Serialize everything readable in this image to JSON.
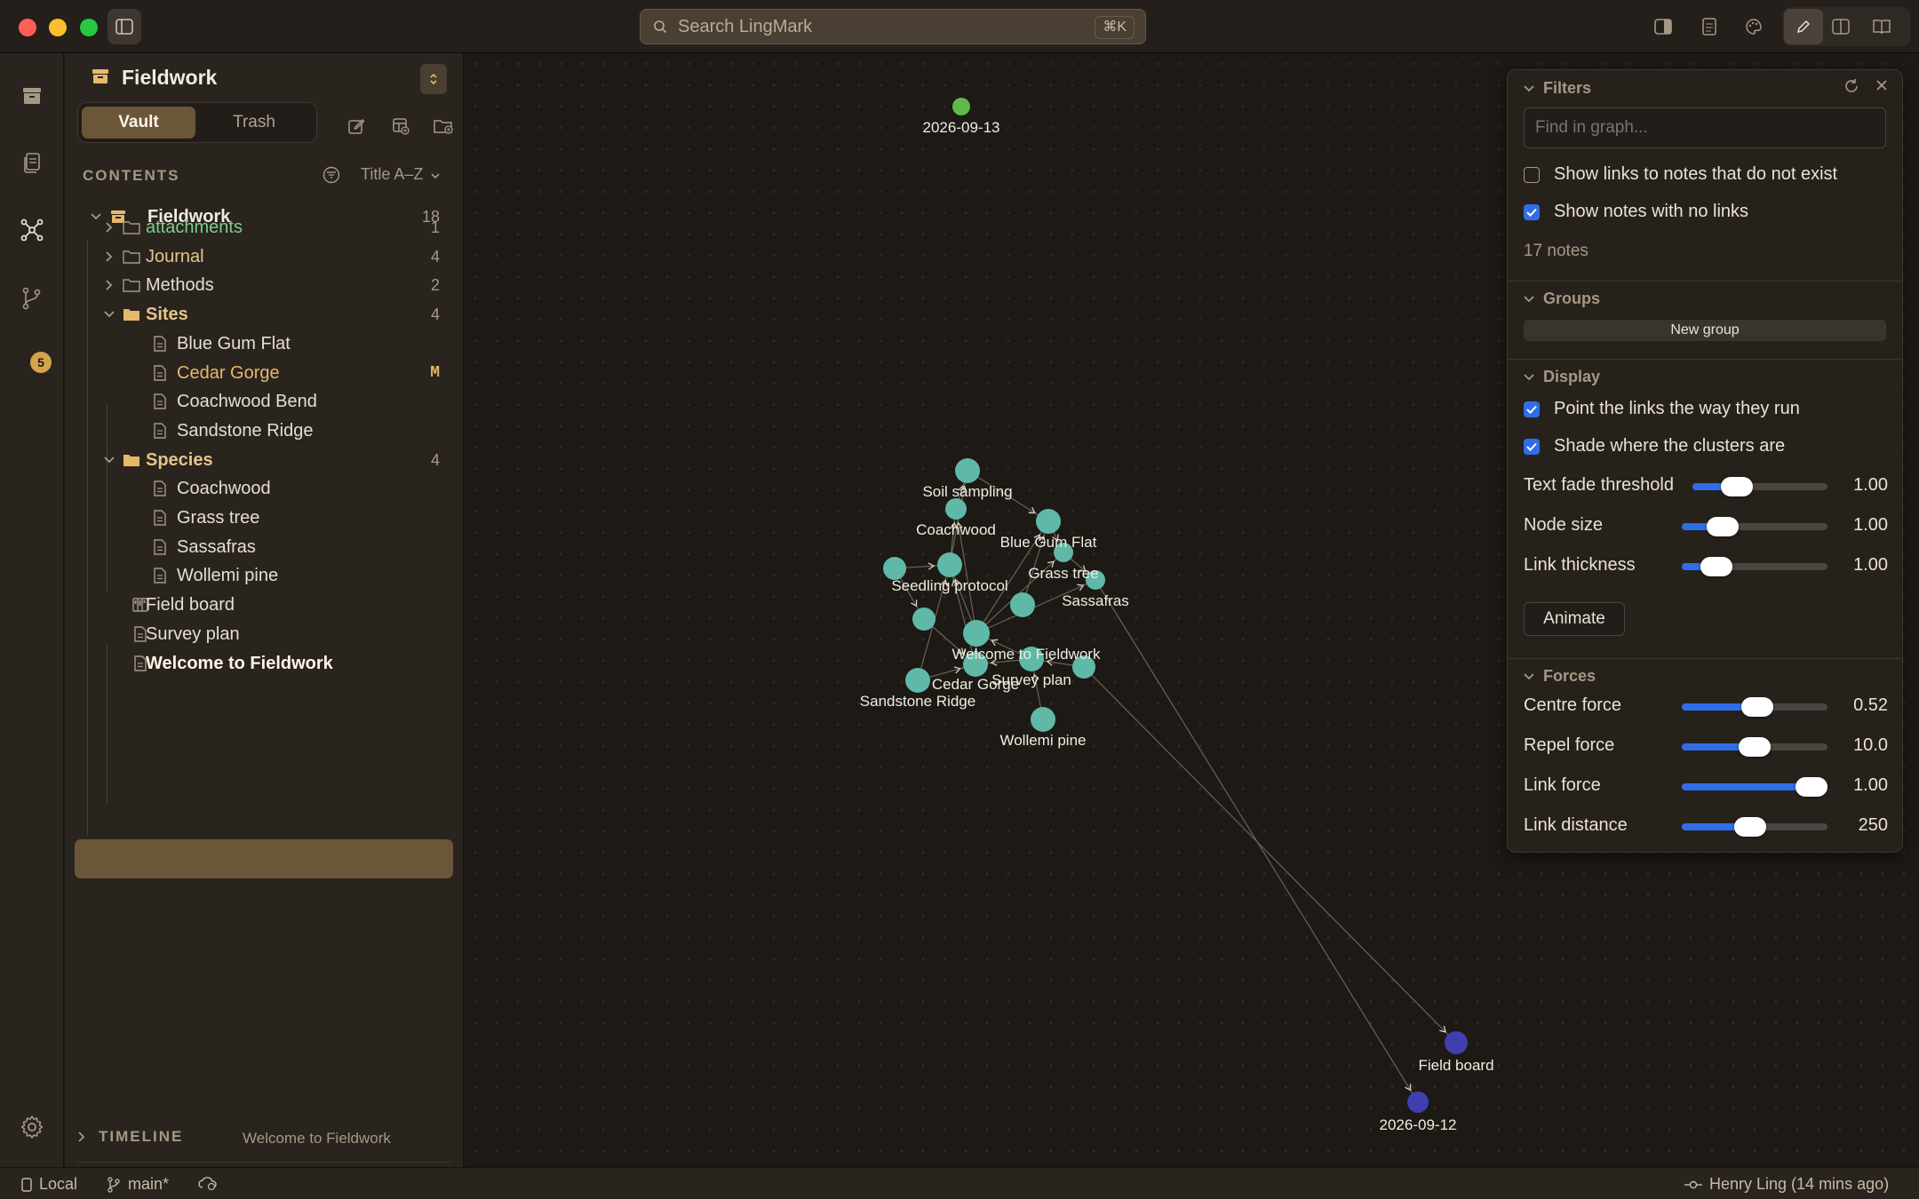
{
  "app": {
    "search_placeholder": "Search LingMark",
    "search_shortcut": "⌘K"
  },
  "rail": {
    "items": [
      {
        "name": "vault-icon"
      },
      {
        "name": "files-icon"
      },
      {
        "name": "graph-icon",
        "active": true
      },
      {
        "name": "git-branch-icon",
        "badge": "5"
      }
    ]
  },
  "vault": {
    "name": "Fieldwork",
    "tabs": [
      "Vault",
      "Trash"
    ],
    "active_tab": "Vault"
  },
  "contents": {
    "heading": "CONTENTS",
    "sort_label": "Title A–Z",
    "root": {
      "label": "Fieldwork",
      "count": "18"
    },
    "rows": [
      {
        "label": "attachments",
        "count": "1",
        "type": "folder",
        "expanded": false,
        "color": "#7dcf8a"
      },
      {
        "label": "Journal",
        "count": "4",
        "type": "folder",
        "expanded": false,
        "color": "#e6c48a"
      },
      {
        "label": "Methods",
        "count": "2",
        "type": "folder",
        "expanded": false,
        "color": "#e6ded2"
      },
      {
        "label": "Sites",
        "count": "4",
        "type": "folder",
        "expanded": true,
        "color": "#e6c48a"
      },
      {
        "label": "Blue Gum Flat",
        "type": "note"
      },
      {
        "label": "Cedar Gorge",
        "type": "note",
        "status": "M",
        "color": "#e6b86a"
      },
      {
        "label": "Coachwood Bend",
        "type": "note"
      },
      {
        "label": "Sandstone Ridge",
        "type": "note"
      },
      {
        "label": "Species",
        "count": "4",
        "type": "folder",
        "expanded": true,
        "color": "#e6c48a"
      },
      {
        "label": "Coachwood",
        "type": "note"
      },
      {
        "label": "Grass tree",
        "type": "note"
      },
      {
        "label": "Sassafras",
        "type": "note"
      },
      {
        "label": "Wollemi pine",
        "type": "note"
      },
      {
        "label": "Field board",
        "type": "board"
      },
      {
        "label": "Survey plan",
        "type": "note"
      },
      {
        "label": "Welcome to Fieldwork",
        "type": "note",
        "selected": true
      }
    ]
  },
  "timeline": {
    "heading": "TIMELINE",
    "note": "Welcome to Fieldwork"
  },
  "graph": {
    "nodes": [
      {
        "id": "2026-09-13",
        "label": "2026-09-13",
        "color": "#5fb84a"
      },
      {
        "id": "soil",
        "label": "Soil sampling",
        "color": "#5fb8a8"
      },
      {
        "id": "coach",
        "label": "Coachwood",
        "color": "#5fb8a8"
      },
      {
        "id": "bgf",
        "label": "Blue Gum Flat",
        "color": "#5fb8a8"
      },
      {
        "id": "grass",
        "label": "Grass tree",
        "color": "#5fb8a8"
      },
      {
        "id": "sass",
        "label": "Sassafras",
        "color": "#5fb8a8"
      },
      {
        "id": "seed",
        "label": "Seedling protocol",
        "color": "#5fb8a8"
      },
      {
        "id": "wel",
        "label": "Welcome to Fieldwork",
        "color": "#5fb8a8"
      },
      {
        "id": "cedar",
        "label": "Cedar Gorge",
        "color": "#5fb8a8"
      },
      {
        "id": "survey",
        "label": "Survey plan",
        "color": "#5fb8a8"
      },
      {
        "id": "sand",
        "label": "Sandstone Ridge",
        "color": "#5fb8a8"
      },
      {
        "id": "woll",
        "label": "Wollemi pine",
        "color": "#5fb8a8"
      },
      {
        "id": "extra1",
        "label": "",
        "color": "#5fb8a8"
      },
      {
        "id": "extra2",
        "label": "",
        "color": "#5fb8a8"
      },
      {
        "id": "extra3",
        "label": "",
        "color": "#5fb8a8"
      },
      {
        "id": "extra4",
        "label": "",
        "color": "#5fb8a8"
      },
      {
        "id": "fb",
        "label": "Field board",
        "color": "#3f3fb0"
      },
      {
        "id": "2026-09-12",
        "label": "2026-09-12",
        "color": "#3f3fb0"
      }
    ],
    "links": [
      [
        "coach",
        "soil"
      ],
      [
        "seed",
        "coach"
      ],
      [
        "seed",
        "soil"
      ],
      [
        "wel",
        "seed"
      ],
      [
        "wel",
        "coach"
      ],
      [
        "wel",
        "bgf"
      ],
      [
        "wel",
        "grass"
      ],
      [
        "wel",
        "sass"
      ],
      [
        "cedar",
        "wel"
      ],
      [
        "cedar",
        "seed"
      ],
      [
        "survey",
        "wel"
      ],
      [
        "survey",
        "cedar"
      ],
      [
        "sand",
        "cedar"
      ],
      [
        "sand",
        "seed"
      ],
      [
        "woll",
        "survey"
      ],
      [
        "extra1",
        "seed"
      ],
      [
        "extra2",
        "cedar"
      ],
      [
        "extra3",
        "survey"
      ],
      [
        "extra4",
        "bgf"
      ],
      [
        "bgf",
        "grass"
      ],
      [
        "grass",
        "sass"
      ],
      [
        "soil",
        "bgf"
      ],
      [
        "extra1",
        "extra2"
      ],
      [
        "extra3",
        "fb"
      ],
      [
        "sass",
        "2026-09-12"
      ]
    ]
  },
  "filters": {
    "title": "Filters",
    "search_placeholder": "Find in graph...",
    "options": [
      {
        "label": "Show links to notes that do not exist",
        "checked": false
      },
      {
        "label": "Show notes with no links",
        "checked": true
      }
    ],
    "note_count": "17 notes",
    "groups_title": "Groups",
    "new_group_label": "New group",
    "display_title": "Display",
    "display_options": [
      {
        "label": "Point the links the way they run",
        "checked": true
      },
      {
        "label": "Shade where the clusters are",
        "checked": true
      }
    ],
    "display_sliders": [
      {
        "label": "Text fade threshold",
        "value": "1.00",
        "level": 0.33
      },
      {
        "label": "Node size",
        "value": "1.00",
        "level": 0.28
      },
      {
        "label": "Link thickness",
        "value": "1.00",
        "level": 0.24
      }
    ],
    "animate_label": "Animate",
    "forces_title": "Forces",
    "force_sliders": [
      {
        "label": "Centre force",
        "value": "0.52",
        "level": 0.52
      },
      {
        "label": "Repel force",
        "value": "10.0",
        "level": 0.5
      },
      {
        "label": "Link force",
        "value": "1.00",
        "level": 1.0
      },
      {
        "label": "Link distance",
        "value": "250",
        "level": 0.47
      }
    ]
  },
  "status": {
    "location": "Local",
    "branch": "main*",
    "author": "Henry Ling (14 mins ago)"
  }
}
